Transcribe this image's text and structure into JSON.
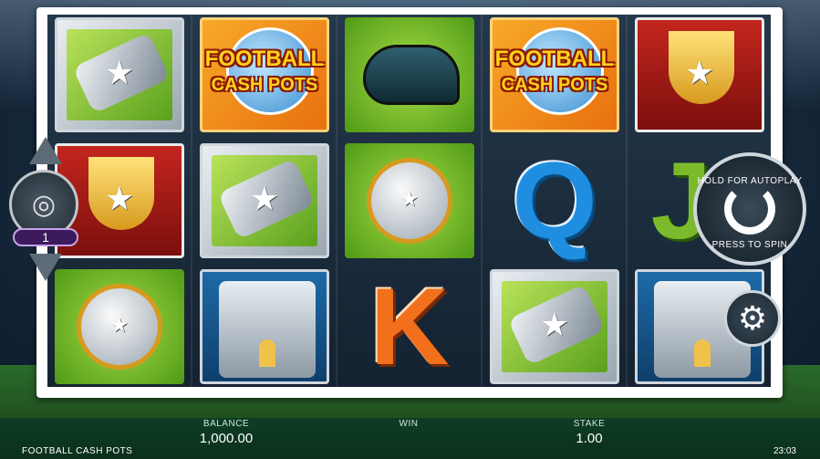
{
  "game": {
    "title": "FOOTBALL CASH POTS",
    "logo_line1": "FOOTBALL",
    "logo_line2": "CASH POTS"
  },
  "reels": [
    [
      "whistle",
      "trophy",
      "silver-trophy-coin"
    ],
    [
      "football-cash-pots-logo",
      "whistle",
      "stadium"
    ],
    [
      "boot",
      "silver-trophy-coin",
      "K"
    ],
    [
      "football-cash-pots-logo",
      "Q",
      "whistle"
    ],
    [
      "trophy",
      "J",
      "stadium"
    ]
  ],
  "letters": {
    "q": "Q",
    "k": "K",
    "j": "J"
  },
  "controls": {
    "stake_level": "1",
    "spin_top_text": "HOLD FOR AUTOPLAY",
    "spin_bottom_text": "PRESS TO SPIN"
  },
  "status": {
    "balance_label": "BALANCE",
    "balance_value": "1,000.00",
    "win_label": "WIN",
    "win_value": "",
    "stake_label": "STAKE",
    "stake_value": "1.00",
    "clock": "23:03"
  },
  "colors": {
    "frame": "#ffffff",
    "q_blue": "#1f8ee0",
    "k_orange": "#f2701b",
    "bar_green": "#0e3d24"
  },
  "icons": {
    "stake_up": "chevron-up-icon",
    "stake_down": "chevron-down-icon",
    "coins": "coin-stack-icon",
    "spin": "spin-arrow-icon",
    "settings": "gear-icon"
  }
}
